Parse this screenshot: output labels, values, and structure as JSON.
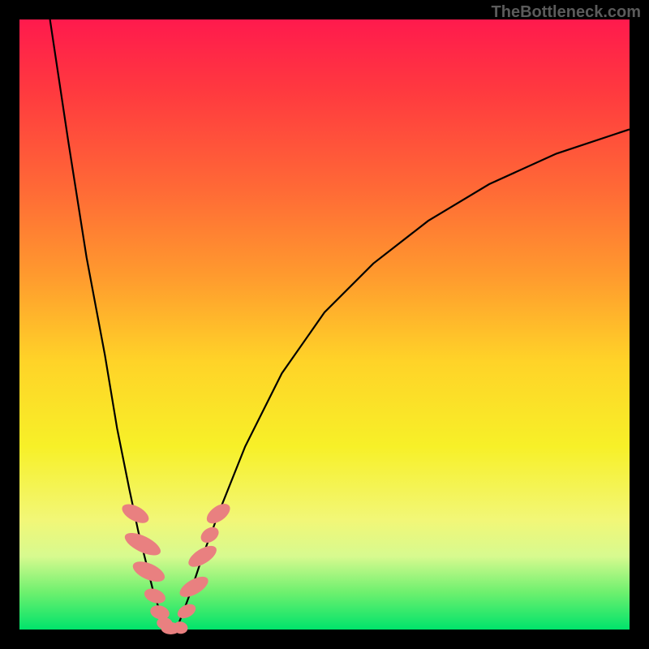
{
  "watermark": "TheBottleneck.com",
  "chart_data": {
    "type": "line",
    "title": "",
    "xlabel": "",
    "ylabel": "",
    "xlim": [
      0,
      100
    ],
    "ylim": [
      0,
      100
    ],
    "grid": false,
    "legend": false,
    "series": [
      {
        "name": "left-branch",
        "x": [
          5,
          8,
          11,
          14,
          16,
          18,
          19.5,
          21,
          22,
          23,
          23.8,
          24.3
        ],
        "values": [
          100,
          80,
          61,
          45,
          33,
          23,
          16,
          10,
          6,
          3,
          1,
          0
        ]
      },
      {
        "name": "right-branch",
        "x": [
          25.7,
          26.5,
          28,
          30,
          33,
          37,
          43,
          50,
          58,
          67,
          77,
          88,
          100
        ],
        "values": [
          0,
          2,
          6,
          12,
          20,
          30,
          42,
          52,
          60,
          67,
          73,
          78,
          82
        ]
      }
    ],
    "annotations": {
      "beads": [
        {
          "branch": "left",
          "x": 19.0,
          "y": 19.0,
          "rx": 1.2,
          "ry": 2.4,
          "rot": -62
        },
        {
          "branch": "left",
          "x": 20.2,
          "y": 14.0,
          "rx": 1.3,
          "ry": 3.2,
          "rot": -64
        },
        {
          "branch": "left",
          "x": 21.2,
          "y": 9.5,
          "rx": 1.3,
          "ry": 2.8,
          "rot": -66
        },
        {
          "branch": "left",
          "x": 22.2,
          "y": 5.5,
          "rx": 1.1,
          "ry": 1.8,
          "rot": -70
        },
        {
          "branch": "left",
          "x": 23.0,
          "y": 2.8,
          "rx": 1.1,
          "ry": 1.6,
          "rot": -74
        },
        {
          "branch": "left",
          "x": 23.8,
          "y": 1.0,
          "rx": 1.0,
          "ry": 1.3,
          "rot": -80
        },
        {
          "branch": "floor",
          "x": 24.8,
          "y": 0.2,
          "rx": 1.6,
          "ry": 1.0,
          "rot": 0
        },
        {
          "branch": "floor",
          "x": 26.4,
          "y": 0.3,
          "rx": 1.2,
          "ry": 1.0,
          "rot": 10
        },
        {
          "branch": "right",
          "x": 27.4,
          "y": 3.0,
          "rx": 1.0,
          "ry": 1.6,
          "rot": 62
        },
        {
          "branch": "right",
          "x": 28.6,
          "y": 7.0,
          "rx": 1.2,
          "ry": 2.6,
          "rot": 60
        },
        {
          "branch": "right",
          "x": 30.0,
          "y": 12.0,
          "rx": 1.2,
          "ry": 2.6,
          "rot": 58
        },
        {
          "branch": "right",
          "x": 31.2,
          "y": 15.5,
          "rx": 1.1,
          "ry": 1.6,
          "rot": 56
        },
        {
          "branch": "right",
          "x": 32.6,
          "y": 19.0,
          "rx": 1.2,
          "ry": 2.2,
          "rot": 54
        }
      ]
    },
    "gradient_stops": [
      {
        "pos": 0,
        "color": "#ff1a4d"
      },
      {
        "pos": 28,
        "color": "#ff6a36"
      },
      {
        "pos": 56,
        "color": "#ffd328"
      },
      {
        "pos": 82,
        "color": "#f2f777"
      },
      {
        "pos": 100,
        "color": "#00e36b"
      }
    ]
  }
}
